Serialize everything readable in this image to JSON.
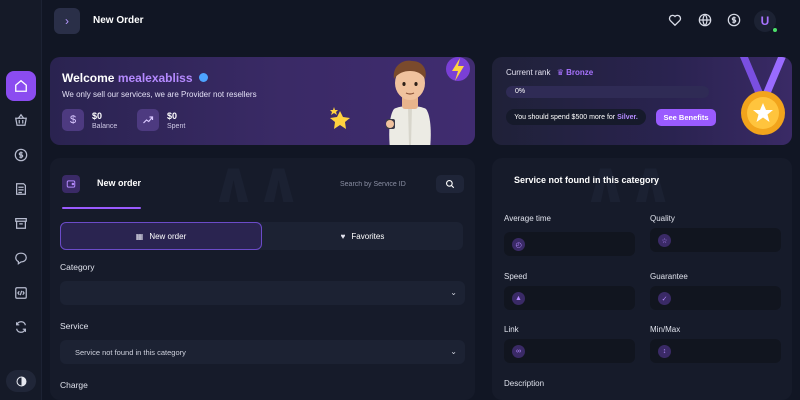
{
  "app": {
    "page_title": "New Order",
    "avatar_letter": "U"
  },
  "sidebar": {
    "items": [
      {
        "name": "home",
        "icon": "home-icon",
        "active": true
      },
      {
        "name": "basket",
        "icon": "basket-icon"
      },
      {
        "name": "funds",
        "icon": "dollar-icon"
      },
      {
        "name": "orders",
        "icon": "orders-icon"
      },
      {
        "name": "archive",
        "icon": "archive-icon"
      },
      {
        "name": "chat",
        "icon": "chat-icon"
      },
      {
        "name": "api",
        "icon": "code-icon"
      },
      {
        "name": "refill",
        "icon": "refresh-icon"
      }
    ]
  },
  "welcome": {
    "greeting": "Welcome",
    "username": "mealexabliss",
    "subtitle": "We only sell our services, we are Provider not resellers",
    "balance_value": "$0",
    "balance_label": "Balance",
    "spent_value": "$0",
    "spent_label": "Spent"
  },
  "rank": {
    "label": "Current rank",
    "name": "Bronze",
    "progress_text": "0%",
    "progress_fraction": 0.0,
    "message_prefix": "You should spend $500 more for",
    "message_target": "Silver.",
    "benefits_button": "See Benefits"
  },
  "order": {
    "tab_label": "New order",
    "search_placeholder": "Search by Service ID",
    "toggle_new": "New order",
    "toggle_fav": "Favorites",
    "category_label": "Category",
    "category_value": "",
    "service_label": "Service",
    "service_value": "Service not found in this category",
    "charge_label": "Charge"
  },
  "service_info": {
    "title": "Service not found in this category",
    "average_time": "Average time",
    "quality": "Quality",
    "speed": "Speed",
    "guarantee": "Guarantee",
    "link": "Link",
    "minmax": "Min/Max",
    "description": "Description"
  },
  "colors": {
    "accent": "#9a5bff",
    "background": "#111624",
    "panel": "#161b2a"
  }
}
